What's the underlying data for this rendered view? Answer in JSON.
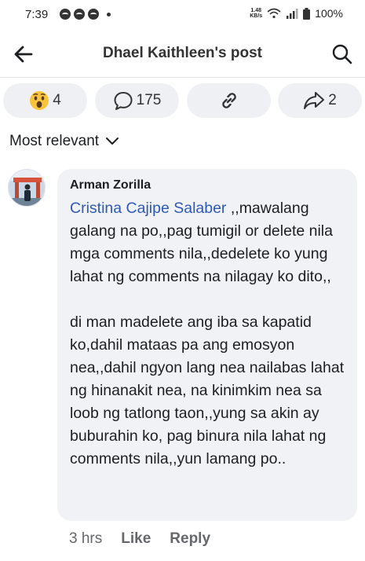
{
  "status_bar": {
    "time": "7:39",
    "net_speed_value": "1.48",
    "net_speed_unit": "KB/s",
    "battery": "100%"
  },
  "header": {
    "title": "Dhael Kaithleen's post",
    "back_icon": "arrow-left-icon",
    "search_icon": "search-icon"
  },
  "stats": {
    "reactions_count": "4",
    "reaction_icon": "wow-emoji-icon",
    "comments_count": "175",
    "comment_icon": "comment-bubble-icon",
    "link_icon": "link-icon",
    "shares_count": "2",
    "share_icon": "share-arrow-icon"
  },
  "sort": {
    "label": "Most relevant",
    "icon": "chevron-down-icon"
  },
  "comment": {
    "author": "Arman Zorilla",
    "mention": "Cristina Cajipe Salaber",
    "text_part1": " ,,mawalang galang na po,,pag tumigil or delete nila mga comments nila,,dedelete ko yung lahat ng comments na nilagay ko dito,,",
    "text_part2": "di man madelete ang iba sa kapatid ko,dahil mataas pa ang emosyon nea,,dahil ngyon lang nea nailabas lahat ng hinanakit nea, na kinimkim nea sa loob ng tatlong taon,,yung sa akin ay buburahin ko, pag binura nila lahat ng comments nila,,yun lamang po..",
    "time": "3 hrs",
    "like_label": "Like",
    "reply_label": "Reply"
  },
  "colors": {
    "accent": "#2e59b8",
    "pill_bg": "#eef0f4",
    "bubble_bg": "#f0f2f5"
  }
}
